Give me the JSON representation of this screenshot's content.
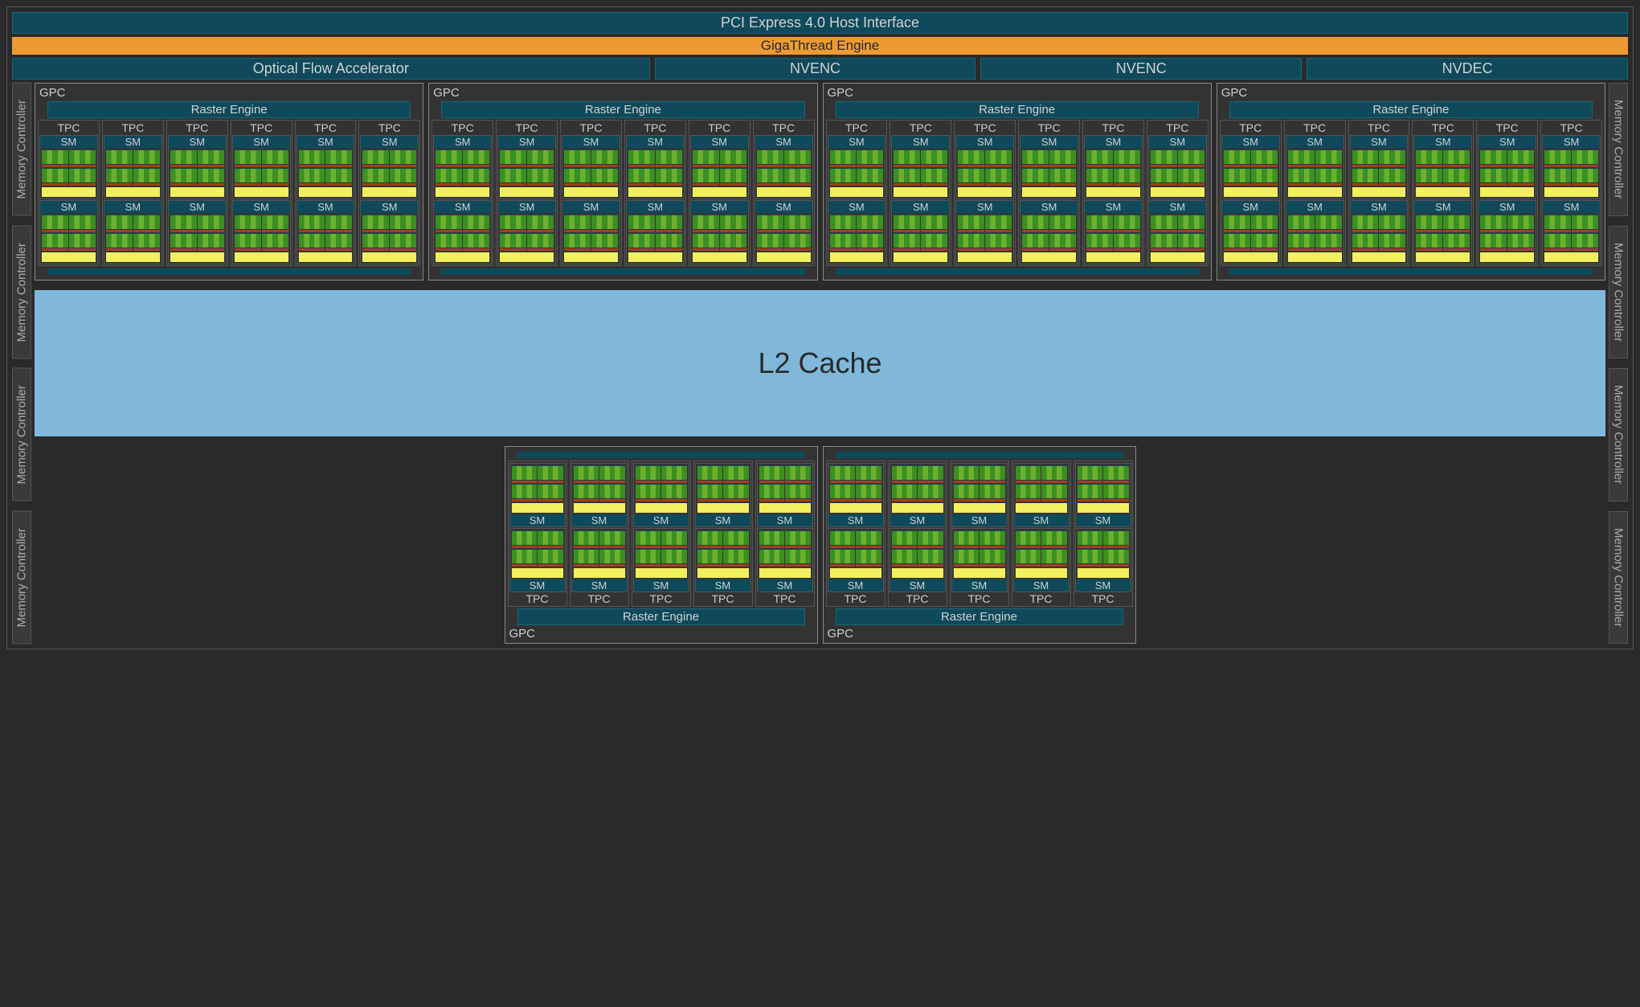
{
  "top": {
    "pcie": "PCI Express 4.0 Host Interface",
    "gigathread": "GigaThread Engine",
    "ofa": "Optical Flow Accelerator",
    "nvenc": "NVENC",
    "nvdec": "NVDEC"
  },
  "mem": "Memory Controller",
  "gpc": {
    "label": "GPC",
    "raster": "Raster Engine",
    "tpc": "TPC",
    "sm": "SM"
  },
  "l2": "L2 Cache",
  "layout": {
    "top_gpc_count": 4,
    "bottom_gpc_count": 2,
    "top_tpc_per_gpc": 6,
    "bottom_tpc_per_gpc": 5,
    "sm_per_tpc": 2,
    "mem_controllers_per_side": 4
  }
}
